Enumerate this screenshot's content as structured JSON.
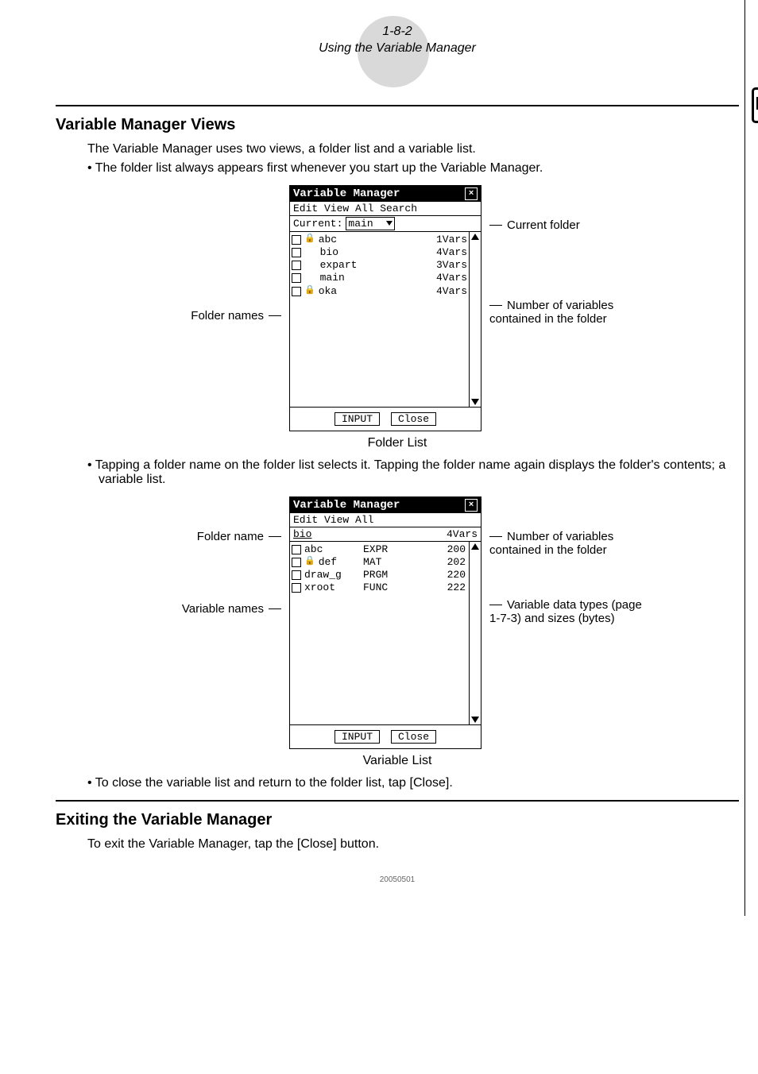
{
  "header": {
    "page_ref": "1-8-2",
    "chapter": "Using the Variable Manager"
  },
  "section1": {
    "title": "Variable Manager Views",
    "intro": "The Variable Manager uses two views, a folder list and a variable list.",
    "bullet1": "• The folder list always appears first whenever you start up the Variable Manager.",
    "bullet2": "• Tapping a folder name on the folder list selects it. Tapping the folder name again displays the folder's contents; a variable list.",
    "bullet3": "• To close the variable list and return to the folder list, tap [Close]."
  },
  "labels": {
    "folder_names": "Folder names",
    "current_folder": "Current folder",
    "num_vars": "Number of variables contained in the folder",
    "folder_name": "Folder name",
    "variable_names": "Variable names",
    "var_types": "Variable data types (page 1-7-3) and sizes (bytes)"
  },
  "shot1": {
    "title": "Variable Manager",
    "menu": "Edit View All Search",
    "current_label": "Current:",
    "current_value": "main",
    "caption": "Folder List",
    "input_btn": "INPUT",
    "close_btn": "Close",
    "folders": [
      {
        "locked": true,
        "name": "abc",
        "count": "1Vars"
      },
      {
        "locked": false,
        "name": "bio",
        "count": "4Vars"
      },
      {
        "locked": false,
        "name": "expart",
        "count": "3Vars"
      },
      {
        "locked": false,
        "name": "main",
        "count": "4Vars"
      },
      {
        "locked": true,
        "name": "oka",
        "count": "4Vars"
      }
    ]
  },
  "shot2": {
    "title": "Variable Manager",
    "menu": "Edit View All",
    "path_name": "bio",
    "path_count": "4Vars",
    "caption": "Variable List",
    "input_btn": "INPUT",
    "close_btn": "Close",
    "vars": [
      {
        "locked": false,
        "name": "abc",
        "type": "EXPR",
        "size": "200"
      },
      {
        "locked": true,
        "name": "def",
        "type": "MAT",
        "size": "202"
      },
      {
        "locked": false,
        "name": "draw_g",
        "type": "PRGM",
        "size": "220"
      },
      {
        "locked": false,
        "name": "xroot",
        "type": "FUNC",
        "size": "222"
      }
    ]
  },
  "section2": {
    "title": "Exiting the Variable Manager",
    "body": "To exit the Variable Manager, tap the [Close] button."
  },
  "footer_code": "20050501"
}
